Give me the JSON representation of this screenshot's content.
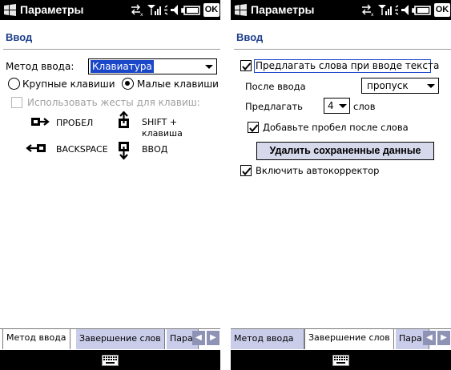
{
  "colors": {
    "title_bar": "#000000",
    "header_text": "#1e3f8c",
    "selection": "#1b47c9",
    "inactive_tab": "#c9cdea",
    "button_bg": "#d6d9ec"
  },
  "left": {
    "title": "Параметры",
    "ok": "OK",
    "header": "Ввод",
    "input_method_label": "Метод ввода:",
    "input_method_value": "Клавиатура",
    "radio_large": "Крупные клавиши",
    "radio_small": "Малые клавиши",
    "radio_small_selected": true,
    "gestures_label": "Использовать жесты для клавиш:",
    "gestures": {
      "space": "ПРОБЕЛ",
      "shift_line1": "SHIFT +",
      "shift_line2": "клавиша",
      "backspace": "BACKSPACE",
      "enter": "ВВОД"
    },
    "tabs": [
      "Метод ввода",
      "Завершение слов",
      "Пара"
    ],
    "active_tab": "Метод ввода"
  },
  "right": {
    "title": "Параметры",
    "ok": "OK",
    "header": "Ввод",
    "suggest_words": "Предлагать слова при вводе текста",
    "suggest_words_checked": true,
    "after_input_label": "После ввода",
    "after_input_value": "пропуск",
    "suggest_label": "Предлагать",
    "suggest_count": "4",
    "suggest_unit": "слов",
    "add_space": "Добавьте пробел после слова",
    "add_space_checked": true,
    "clear_button": "Удалить сохраненные данные",
    "autocorrect": "Включить автокорректор",
    "autocorrect_checked": true,
    "tabs": [
      "Метод ввода",
      "Завершение слов",
      "Пара"
    ],
    "active_tab": "Завершение слов"
  },
  "icons": [
    "windows-logo-icon",
    "sync-icon",
    "signal-icon",
    "volume-icon",
    "battery-icon",
    "keyboard-icon",
    "scroll-left-icon",
    "scroll-right-icon"
  ]
}
